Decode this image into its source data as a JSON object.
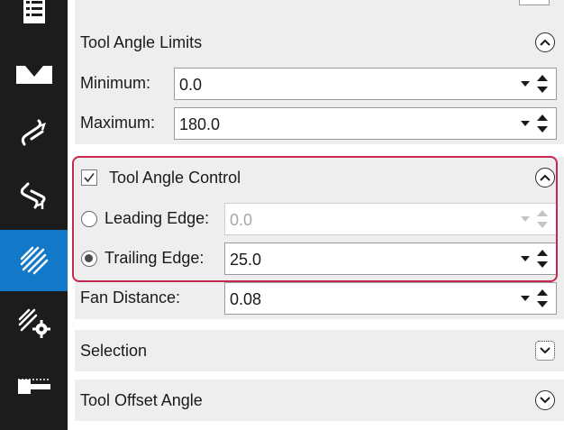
{
  "sidebar": {
    "items": [
      {
        "icon": "list-icon"
      },
      {
        "icon": "bowl-icon"
      },
      {
        "icon": "toolpath-in-icon"
      },
      {
        "icon": "toolpath-out-icon"
      },
      {
        "icon": "parallel-lines-icon",
        "active": true
      },
      {
        "icon": "toolpath-settings-icon"
      },
      {
        "icon": "tool-icon"
      }
    ],
    "active_color": "#1278c8"
  },
  "tool_angle_limits": {
    "title": "Tool Angle Limits",
    "minimum_label": "Minimum:",
    "minimum_value": "0.0",
    "maximum_label": "Maximum:",
    "maximum_value": "180.0"
  },
  "tool_angle_control": {
    "title": "Tool Angle Control",
    "checked": true,
    "leading_edge_label": "Leading Edge:",
    "leading_edge_value": "0.0",
    "trailing_edge_label": "Trailing Edge:",
    "trailing_edge_value": "25.0",
    "selected": "trailing_edge",
    "highlight_color": "#c8264e"
  },
  "fan_distance": {
    "label": "Fan Distance:",
    "value": "0.08"
  },
  "selection": {
    "title": "Selection"
  },
  "tool_offset_angle": {
    "title": "Tool Offset Angle"
  }
}
